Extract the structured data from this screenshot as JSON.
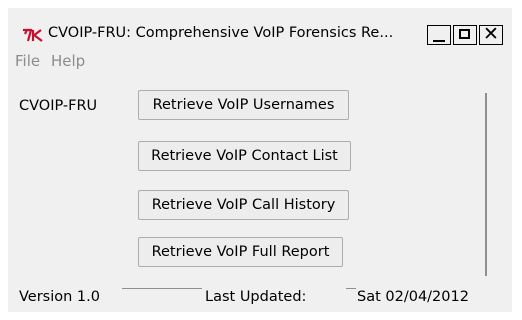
{
  "window": {
    "title": "CVOIP-FRU: Comprehensive VoIP Forensics Re...",
    "icon": "tk-feather-icon",
    "controls": {
      "minimize": "minimize-icon",
      "maximize": "maximize-icon",
      "close": "✕"
    }
  },
  "menu": {
    "items": [
      "File",
      "Help"
    ]
  },
  "main": {
    "app_label": "CVOIP-FRU",
    "buttons": [
      "Retrieve VoIP Usernames",
      "Retrieve VoIP Contact List",
      "Retrieve VoIP Call History",
      "Retrieve VoIP Full Report"
    ]
  },
  "footer": {
    "version": "Version 1.0",
    "updated_label": "Last Updated:",
    "updated_date": "Sat 02/04/2012"
  },
  "colors": {
    "window_bg": "#f0f0f0",
    "menu_text": "#8c8c8c",
    "icon_red": "#c8102e"
  }
}
